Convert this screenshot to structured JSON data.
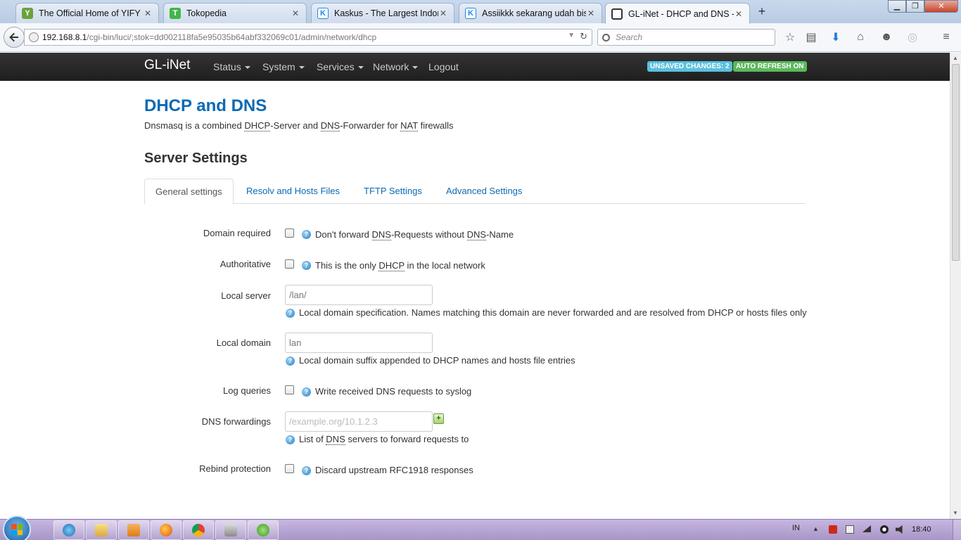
{
  "browser": {
    "tabs": [
      {
        "title": "The Official Home of YIFY ...",
        "icon": "yify-icon",
        "active": false
      },
      {
        "title": "Tokopedia",
        "icon": "tokopedia-icon",
        "active": false
      },
      {
        "title": "Kaskus - The Largest Indon...",
        "icon": "kaskus-icon",
        "active": false
      },
      {
        "title": "Assiikkk sekarang udah bis...",
        "icon": "kaskus-icon",
        "active": false
      },
      {
        "title": "GL-iNet - DHCP and DNS -...",
        "icon": "gl-inet-icon",
        "active": true
      }
    ],
    "url_host": "192.168.8.1",
    "url_path": "/cgi-bin/luci/;stok=dd002118fa5e95035b64abf332069c01/admin/network/dhcp",
    "search_placeholder": "Search"
  },
  "luci": {
    "brand": "GL-iNet",
    "menu": [
      {
        "label": "Status",
        "dropdown": true
      },
      {
        "label": "System",
        "dropdown": true
      },
      {
        "label": "Services",
        "dropdown": true
      },
      {
        "label": "Network",
        "dropdown": true
      },
      {
        "label": "Logout",
        "dropdown": false
      }
    ],
    "badges": {
      "unsaved": "UNSAVED CHANGES: 2",
      "autorefresh": "AUTO REFRESH ON",
      "unsaved_color": "#5bc0de",
      "autorefresh_color": "#5cb85c"
    }
  },
  "page": {
    "title": "DHCP and DNS",
    "desc_part1": "Dnsmasq is a combined ",
    "desc_abbr1": "DHCP",
    "desc_part2": "-Server and ",
    "desc_abbr2": "DNS",
    "desc_part3": "-Forwarder for ",
    "desc_abbr3": "NAT",
    "desc_part4": " firewalls",
    "section_title": "Server Settings",
    "tabs": [
      "General settings",
      "Resolv and Hosts Files",
      "TFTP Settings",
      "Advanced Settings"
    ]
  },
  "fields": {
    "domain_required": {
      "label": "Domain required",
      "h1": "Don't forward ",
      "a1": "DNS",
      "h2": "-Requests without ",
      "a2": "DNS",
      "h3": "-Name",
      "checked": false
    },
    "authoritative": {
      "label": "Authoritative",
      "h1": "This is the only ",
      "a1": "DHCP",
      "h2": " in the local network",
      "checked": false
    },
    "local_server": {
      "label": "Local server",
      "value": "/lan/",
      "help": "Local domain specification. Names matching this domain are never forwarded and are resolved from DHCP or hosts files only"
    },
    "local_domain": {
      "label": "Local domain",
      "value": "lan",
      "help": "Local domain suffix appended to DHCP names and hosts file entries"
    },
    "log_queries": {
      "label": "Log queries",
      "help": "Write received DNS requests to syslog",
      "checked": false
    },
    "dns_forwardings": {
      "label": "DNS forwardings",
      "placeholder": "/example.org/10.1.2.3",
      "h1": "List of ",
      "a1": "DNS",
      "h2": " servers to forward requests to"
    },
    "rebind_protection": {
      "label": "Rebind protection",
      "help": "Discard upstream RFC1918 responses",
      "checked": false
    }
  },
  "taskbar": {
    "language": "IN",
    "clock": "18:40"
  },
  "colors": {
    "accent": "#0b6ab4",
    "header_bg": "#222222"
  }
}
